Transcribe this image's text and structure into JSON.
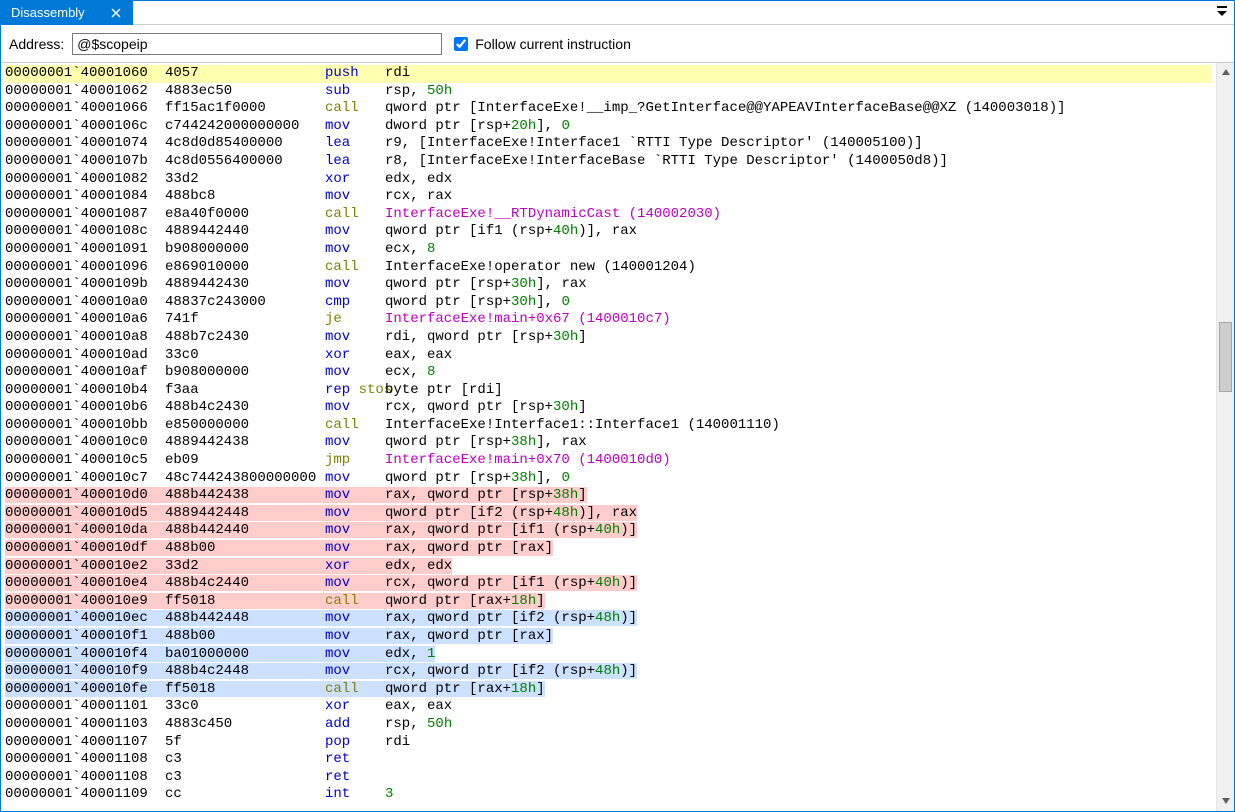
{
  "window": {
    "title": "Disassembly"
  },
  "toolbar": {
    "address_label": "Address:",
    "address_value": "@$scopeip",
    "follow_label": "Follow current instruction",
    "follow_checked": true
  },
  "rows": [
    {
      "hl": "yellow",
      "addr": "00000001`40001060",
      "bytes": "4057",
      "mn": "push",
      "mc": "blue",
      "op": "rdi"
    },
    {
      "addr": "00000001`40001062",
      "bytes": "4883ec50",
      "mn": "sub",
      "mc": "blue",
      "op": "rsp, <n>50h</n>"
    },
    {
      "addr": "00000001`40001066",
      "bytes": "ff15ac1f0000",
      "mn": "call",
      "mc": "olive",
      "op": "qword ptr [InterfaceExe!__imp_?GetInterface@@YAPEAVInterfaceBase@@XZ (140003018)]"
    },
    {
      "addr": "00000001`4000106c",
      "bytes": "c744242000000000",
      "mn": "mov",
      "mc": "blue",
      "op": "dword ptr [rsp+<n>20h</n>], <n>0</n>"
    },
    {
      "addr": "00000001`40001074",
      "bytes": "4c8d0d85400000",
      "mn": "lea",
      "mc": "blue",
      "op": "r9, [InterfaceExe!Interface1 `RTTI Type Descriptor' (140005100)]"
    },
    {
      "addr": "00000001`4000107b",
      "bytes": "4c8d0556400000",
      "mn": "lea",
      "mc": "blue",
      "op": "r8, [InterfaceExe!InterfaceBase `RTTI Type Descriptor' (1400050d8)]"
    },
    {
      "addr": "00000001`40001082",
      "bytes": "33d2",
      "mn": "xor",
      "mc": "blue",
      "op": "edx, edx"
    },
    {
      "addr": "00000001`40001084",
      "bytes": "488bc8",
      "mn": "mov",
      "mc": "blue",
      "op": "rcx, rax"
    },
    {
      "addr": "00000001`40001087",
      "bytes": "e8a40f0000",
      "mn": "call",
      "mc": "olive",
      "op": "<s>InterfaceExe!__RTDynamicCast (140002030)</s>"
    },
    {
      "addr": "00000001`4000108c",
      "bytes": "4889442440",
      "mn": "mov",
      "mc": "blue",
      "op": "qword ptr [if1 (rsp+<n>40h</n>)], rax"
    },
    {
      "addr": "00000001`40001091",
      "bytes": "b908000000",
      "mn": "mov",
      "mc": "blue",
      "op": "ecx, <n>8</n>"
    },
    {
      "addr": "00000001`40001096",
      "bytes": "e869010000",
      "mn": "call",
      "mc": "olive",
      "op": "InterfaceExe!operator new (140001204)"
    },
    {
      "addr": "00000001`4000109b",
      "bytes": "4889442430",
      "mn": "mov",
      "mc": "blue",
      "op": "qword ptr [rsp+<n>30h</n>], rax"
    },
    {
      "addr": "00000001`400010a0",
      "bytes": "48837c243000",
      "mn": "cmp",
      "mc": "blue",
      "op": "qword ptr [rsp+<n>30h</n>], <n>0</n>"
    },
    {
      "addr": "00000001`400010a6",
      "bytes": "741f",
      "mn": "je",
      "mc": "olive",
      "op": "<s>InterfaceExe!main+0x67 (1400010c7)</s>"
    },
    {
      "addr": "00000001`400010a8",
      "bytes": "488b7c2430",
      "mn": "mov",
      "mc": "blue",
      "op": "rdi, qword ptr [rsp+<n>30h</n>]"
    },
    {
      "addr": "00000001`400010ad",
      "bytes": "33c0",
      "mn": "xor",
      "mc": "blue",
      "op": "eax, eax"
    },
    {
      "addr": "00000001`400010af",
      "bytes": "b908000000",
      "mn": "mov",
      "mc": "blue",
      "op": "ecx, <n>8</n>"
    },
    {
      "addr": "00000001`400010b4",
      "bytes": "f3aa",
      "mn": "rep stos",
      "mc": "prefix",
      "op": "byte ptr [rdi]"
    },
    {
      "addr": "00000001`400010b6",
      "bytes": "488b4c2430",
      "mn": "mov",
      "mc": "blue",
      "op": "rcx, qword ptr [rsp+<n>30h</n>]"
    },
    {
      "addr": "00000001`400010bb",
      "bytes": "e850000000",
      "mn": "call",
      "mc": "olive",
      "op": "InterfaceExe!Interface1::Interface1 (140001110)"
    },
    {
      "addr": "00000001`400010c0",
      "bytes": "4889442438",
      "mn": "mov",
      "mc": "blue",
      "op": "qword ptr [rsp+<n>38h</n>], rax"
    },
    {
      "addr": "00000001`400010c5",
      "bytes": "eb09",
      "mn": "jmp",
      "mc": "olive",
      "op": "<s>InterfaceExe!main+0x70 (1400010d0)</s>"
    },
    {
      "addr": "00000001`400010c7",
      "bytes": "48c744243800000000",
      "mn": "mov",
      "mc": "blue",
      "op": "qword ptr [rsp+<n>38h</n>], <n>0</n>"
    },
    {
      "hl": "red",
      "addr": "00000001`400010d0",
      "bytes": "488b442438",
      "mn": "mov",
      "mc": "blue",
      "op": "rax, qword ptr [rsp+<n>38h</n>]"
    },
    {
      "hl": "red",
      "addr": "00000001`400010d5",
      "bytes": "4889442448",
      "mn": "mov",
      "mc": "blue",
      "op": "qword ptr [if2 (rsp+<n>48h</n>)], rax"
    },
    {
      "hl": "red",
      "addr": "00000001`400010da",
      "bytes": "488b442440",
      "mn": "mov",
      "mc": "blue",
      "op": "rax, qword ptr [if1 (rsp+<n>40h</n>)]"
    },
    {
      "hl": "red",
      "addr": "00000001`400010df",
      "bytes": "488b00",
      "mn": "mov",
      "mc": "blue",
      "op": "rax, qword ptr [rax]"
    },
    {
      "hl": "red",
      "addr": "00000001`400010e2",
      "bytes": "33d2",
      "mn": "xor",
      "mc": "blue",
      "op": "edx, edx"
    },
    {
      "hl": "red",
      "addr": "00000001`400010e4",
      "bytes": "488b4c2440",
      "mn": "mov",
      "mc": "blue",
      "op": "rcx, qword ptr [if1 (rsp+<n>40h</n>)]"
    },
    {
      "hl": "red",
      "addr": "00000001`400010e9",
      "bytes": "ff5018",
      "mn": "call",
      "mc": "olive",
      "op": "qword ptr [rax+<n>18h</n>]"
    },
    {
      "hl": "blue",
      "addr": "00000001`400010ec",
      "bytes": "488b442448",
      "mn": "mov",
      "mc": "blue",
      "op": "rax, qword ptr [if2 (rsp+<n>48h</n>)]"
    },
    {
      "hl": "blue",
      "addr": "00000001`400010f1",
      "bytes": "488b00",
      "mn": "mov",
      "mc": "blue",
      "op": "rax, qword ptr [rax]"
    },
    {
      "hl": "blue",
      "addr": "00000001`400010f4",
      "bytes": "ba01000000",
      "mn": "mov",
      "mc": "blue",
      "op": "edx, <n>1</n>"
    },
    {
      "hl": "blue",
      "addr": "00000001`400010f9",
      "bytes": "488b4c2448",
      "mn": "mov",
      "mc": "blue",
      "op": "rcx, qword ptr [if2 (rsp+<n>48h</n>)]"
    },
    {
      "hl": "blue",
      "addr": "00000001`400010fe",
      "bytes": "ff5018",
      "mn": "call",
      "mc": "olive",
      "op": "qword ptr [rax+<n>18h</n>]"
    },
    {
      "addr": "00000001`40001101",
      "bytes": "33c0",
      "mn": "xor",
      "mc": "blue",
      "op": "eax, eax"
    },
    {
      "addr": "00000001`40001103",
      "bytes": "4883c450",
      "mn": "add",
      "mc": "blue",
      "op": "rsp, <n>50h</n>"
    },
    {
      "addr": "00000001`40001107",
      "bytes": "5f",
      "mn": "pop",
      "mc": "blue",
      "op": "rdi"
    },
    {
      "addr": "00000001`40001108",
      "bytes": "c3",
      "mn": "ret",
      "mc": "blue",
      "op": ""
    },
    {
      "addr": "00000001`40001108",
      "bytes": "c3",
      "mn": "ret",
      "mc": "blue",
      "op": ""
    },
    {
      "addr": "00000001`40001109",
      "bytes": "cc",
      "mn": "int",
      "mc": "blue",
      "op": "<n>3</n>"
    }
  ]
}
